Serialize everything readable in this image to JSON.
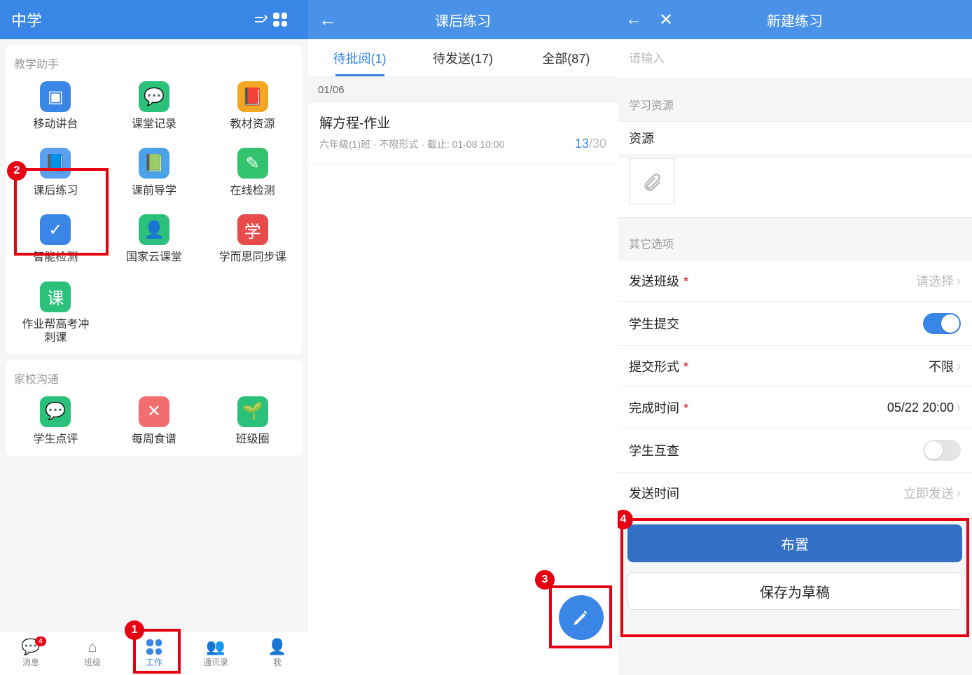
{
  "panel1": {
    "header_title": "中学",
    "section1_label": "教学助手",
    "apps1": [
      {
        "label": "移动讲台",
        "color": "#3a86e6",
        "glyph": "▣"
      },
      {
        "label": "课堂记录",
        "color": "#2bc17b",
        "glyph": "💬"
      },
      {
        "label": "教材资源",
        "color": "#f5a623",
        "glyph": "📕"
      },
      {
        "label": "课后练习",
        "color": "#5b9ff0",
        "glyph": "📘"
      },
      {
        "label": "课前导学",
        "color": "#4aa3e8",
        "glyph": "📗"
      },
      {
        "label": "在线检测",
        "color": "#33c26e",
        "glyph": "✎"
      },
      {
        "label": "智能检测",
        "color": "#3a86e6",
        "glyph": "✓"
      },
      {
        "label": "国家云课堂",
        "color": "#2bc17b",
        "glyph": "👤"
      },
      {
        "label": "学而思同步课",
        "color": "#e94b4b",
        "glyph": "学"
      },
      {
        "label": "作业帮高考冲刺课",
        "color": "#2bc17b",
        "glyph": "课"
      }
    ],
    "section2_label": "家校沟通",
    "apps2": [
      {
        "label": "学生点评",
        "color": "#2bc17b",
        "glyph": "💬"
      },
      {
        "label": "每周食谱",
        "color": "#f26d6d",
        "glyph": "✕"
      },
      {
        "label": "班级圈",
        "color": "#2bc17b",
        "glyph": "🌱"
      }
    ],
    "tabs": [
      {
        "label": "消息",
        "badge": "4"
      },
      {
        "label": "班级"
      },
      {
        "label": "工作",
        "active": true
      },
      {
        "label": "通讯录"
      },
      {
        "label": "我"
      }
    ]
  },
  "panel2": {
    "header_title": "课后练习",
    "tabs": [
      {
        "label": "待批阅(1)",
        "active": true
      },
      {
        "label": "待发送(17)"
      },
      {
        "label": "全部(87)"
      }
    ],
    "date": "01/06",
    "assignment": {
      "title": "解方程-作业",
      "subtitle": "六年级(1)班 · 不限形式 · 截止: 01-08 10:00",
      "done": "13",
      "total": "/30"
    }
  },
  "panel3": {
    "header_title": "新建练习",
    "input_placeholder": "请输入",
    "section_a": "学习资源",
    "resource_label": "资源",
    "section_b": "其它选项",
    "rows": {
      "send_class": {
        "label": "发送班级",
        "required": true,
        "value": "请选择",
        "gray": true
      },
      "student_submit": {
        "label": "学生提交",
        "switch": true,
        "on": true
      },
      "submit_form": {
        "label": "提交形式",
        "required": true,
        "value": "不限"
      },
      "finish_time": {
        "label": "完成时间",
        "required": true,
        "value": "05/22 20:00"
      },
      "peer_check": {
        "label": "学生互查",
        "switch": true,
        "on": false
      },
      "send_time": {
        "label": "发送时间",
        "value": "立即发送",
        "gray": true
      }
    },
    "buttons": {
      "primary": "布置",
      "secondary": "保存为草稿"
    }
  },
  "callouts": {
    "c1": "1",
    "c2": "2",
    "c3": "3",
    "c4": "4"
  }
}
